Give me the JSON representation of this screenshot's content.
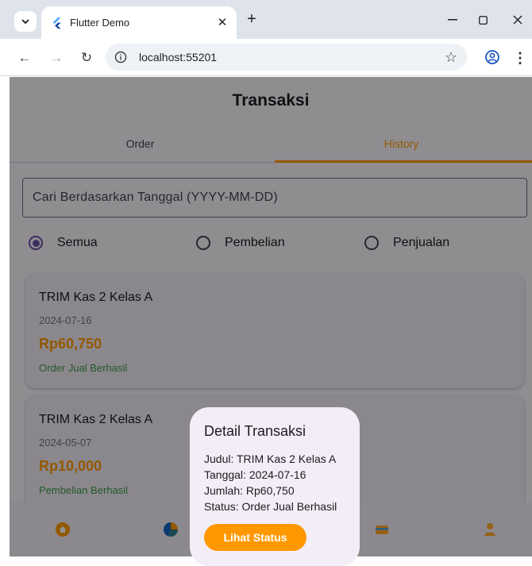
{
  "browser": {
    "tab_title": "Flutter Demo",
    "url": "localhost:55201",
    "icons": [
      "tab-search-icon",
      "flutter-icon",
      "close-icon",
      "plus-icon",
      "minimize-icon",
      "maximize-icon",
      "window-close-icon",
      "back-icon",
      "forward-icon",
      "reload-icon",
      "info-icon",
      "star-icon",
      "profile-icon",
      "more-icon"
    ]
  },
  "app": {
    "title": "Transaksi",
    "tabs": [
      {
        "label": "Order",
        "selected": false
      },
      {
        "label": "History",
        "selected": true
      }
    ],
    "search": {
      "placeholder": "Cari Berdasarkan Tanggal (YYYY-MM-DD)",
      "value": ""
    },
    "filters": {
      "options": [
        "Semua",
        "Pembelian",
        "Penjualan"
      ],
      "selected": "Semua"
    },
    "transactions": [
      {
        "title": "TRIM Kas 2 Kelas A",
        "date": "2024-07-16",
        "amount": "Rp60,750",
        "status": "Order Jual Berhasil"
      },
      {
        "title": "TRIM Kas 2 Kelas A",
        "date": "2024-05-07",
        "amount": "Rp10,000",
        "status": "Pembelian Berhasil"
      }
    ],
    "bottom_nav_icons": [
      "home-icon",
      "pie-chart-icon",
      "wallet-icon",
      "person-icon"
    ]
  },
  "dialog": {
    "title": "Detail Transaksi",
    "lines": [
      "Judul: TRIM Kas 2 Kelas A",
      "Tanggal: 2024-07-16",
      "Jumlah: Rp60,750",
      "Status: Order Jual Berhasil"
    ],
    "button_label": "Lihat Status"
  },
  "colors": {
    "accent": "#ff9800",
    "success": "#3f9a45",
    "radio_selected": "#6750a4"
  }
}
